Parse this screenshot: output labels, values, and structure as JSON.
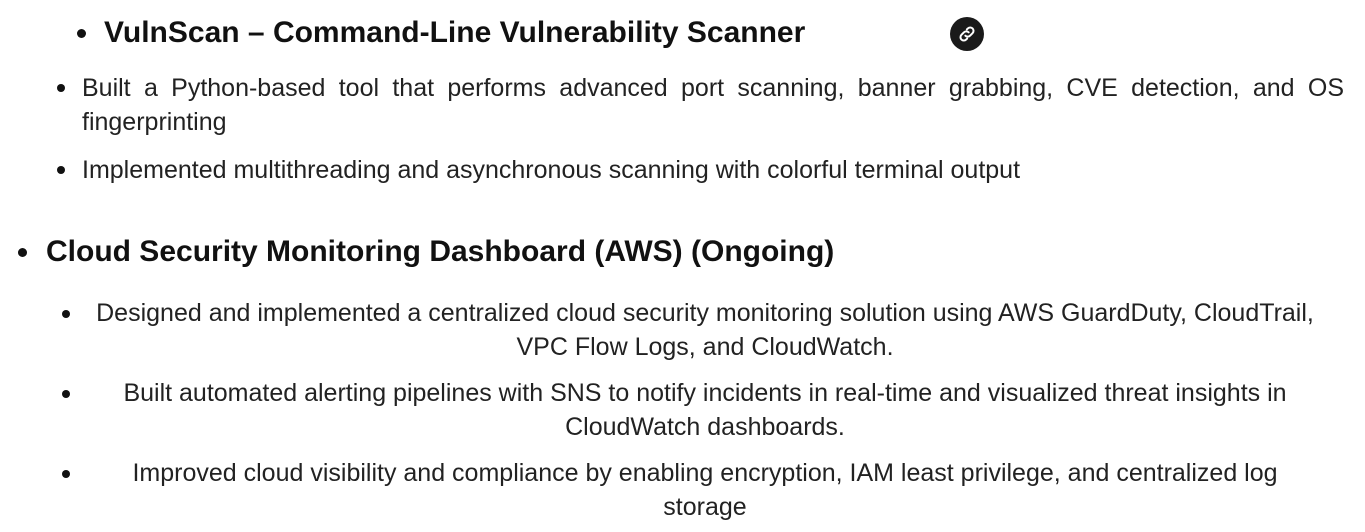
{
  "project1": {
    "title": "VulnScan – Command-Line Vulnerability Scanner",
    "link_icon": "link-icon",
    "bullets": [
      "Built a Python-based tool that performs advanced port scanning, banner grabbing, CVE detection, and OS fingerprinting",
      "Implemented multithreading and asynchronous scanning with colorful terminal output"
    ]
  },
  "project2": {
    "title": "Cloud Security Monitoring Dashboard (AWS) (Ongoing)",
    "bullets": [
      "Designed and implemented a centralized cloud security monitoring solution using AWS GuardDuty, CloudTrail, VPC Flow Logs, and CloudWatch.",
      "Built automated alerting pipelines with SNS to notify incidents in real-time and visualized threat insights in CloudWatch dashboards.",
      "Improved cloud visibility and compliance by enabling encryption, IAM least privilege, and centralized log storage"
    ]
  }
}
